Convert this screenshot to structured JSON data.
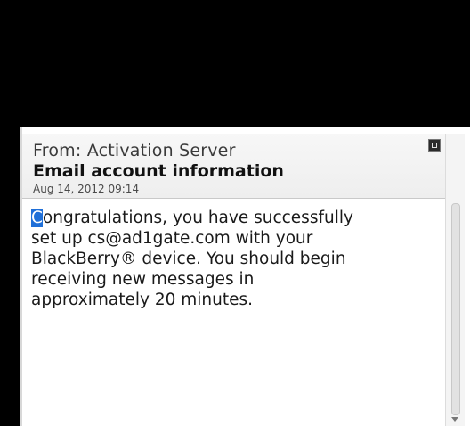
{
  "message": {
    "from": "From: Activation Server",
    "subject": "Email account information",
    "date": "Aug 14, 2012 09:14",
    "body_first_letter": "C",
    "body_rest": "ongratulations, you have successfully\nset up cs@ad1gate.com with your\nBlackBerry® device. You should begin\nreceiving new messages in\napproximately 20 minutes."
  },
  "icons": {
    "corner": "maximize-icon",
    "scroll": "scroll-down-arrow-icon"
  },
  "colors": {
    "cursor_highlight": "#1f6fd8",
    "background": "#ffffff",
    "bezel": "#000000"
  }
}
